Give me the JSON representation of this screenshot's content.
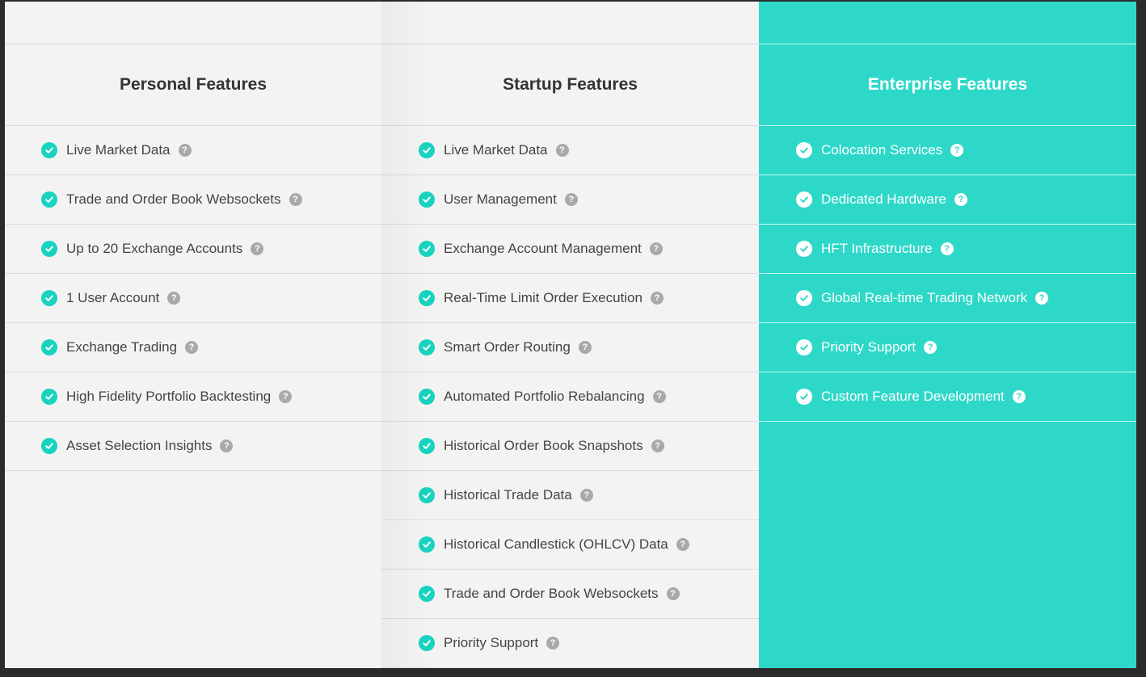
{
  "columns": [
    {
      "key": "personal",
      "title": "Personal Features",
      "items": [
        "Live Market Data",
        "Trade and Order Book Websockets",
        "Up to 20 Exchange Accounts",
        "1 User Account",
        "Exchange Trading",
        "High Fidelity Portfolio Backtesting",
        "Asset Selection Insights"
      ]
    },
    {
      "key": "startup",
      "title": "Startup Features",
      "items": [
        "Live Market Data",
        "User Management",
        "Exchange Account Management",
        "Real-Time Limit Order Execution",
        "Smart Order Routing",
        "Automated Portfolio Rebalancing",
        "Historical Order Book Snapshots",
        "Historical Trade Data",
        "Historical Candlestick (OHLCV) Data",
        "Trade and Order Book Websockets",
        "Priority Support"
      ]
    },
    {
      "key": "enterprise",
      "title": "Enterprise Features",
      "items": [
        "Colocation Services",
        "Dedicated Hardware",
        "HFT Infrastructure",
        "Global Real-time Trading Network",
        "Priority Support",
        "Custom Feature Development"
      ]
    }
  ],
  "icons": {
    "check": "check-circle-icon",
    "help": "question-circle-icon",
    "help_glyph": "?"
  },
  "colors": {
    "accent": "#2ed8c8",
    "check": "#18d3c0",
    "help": "#a9a9a9",
    "panel": "#f3f3f3"
  }
}
